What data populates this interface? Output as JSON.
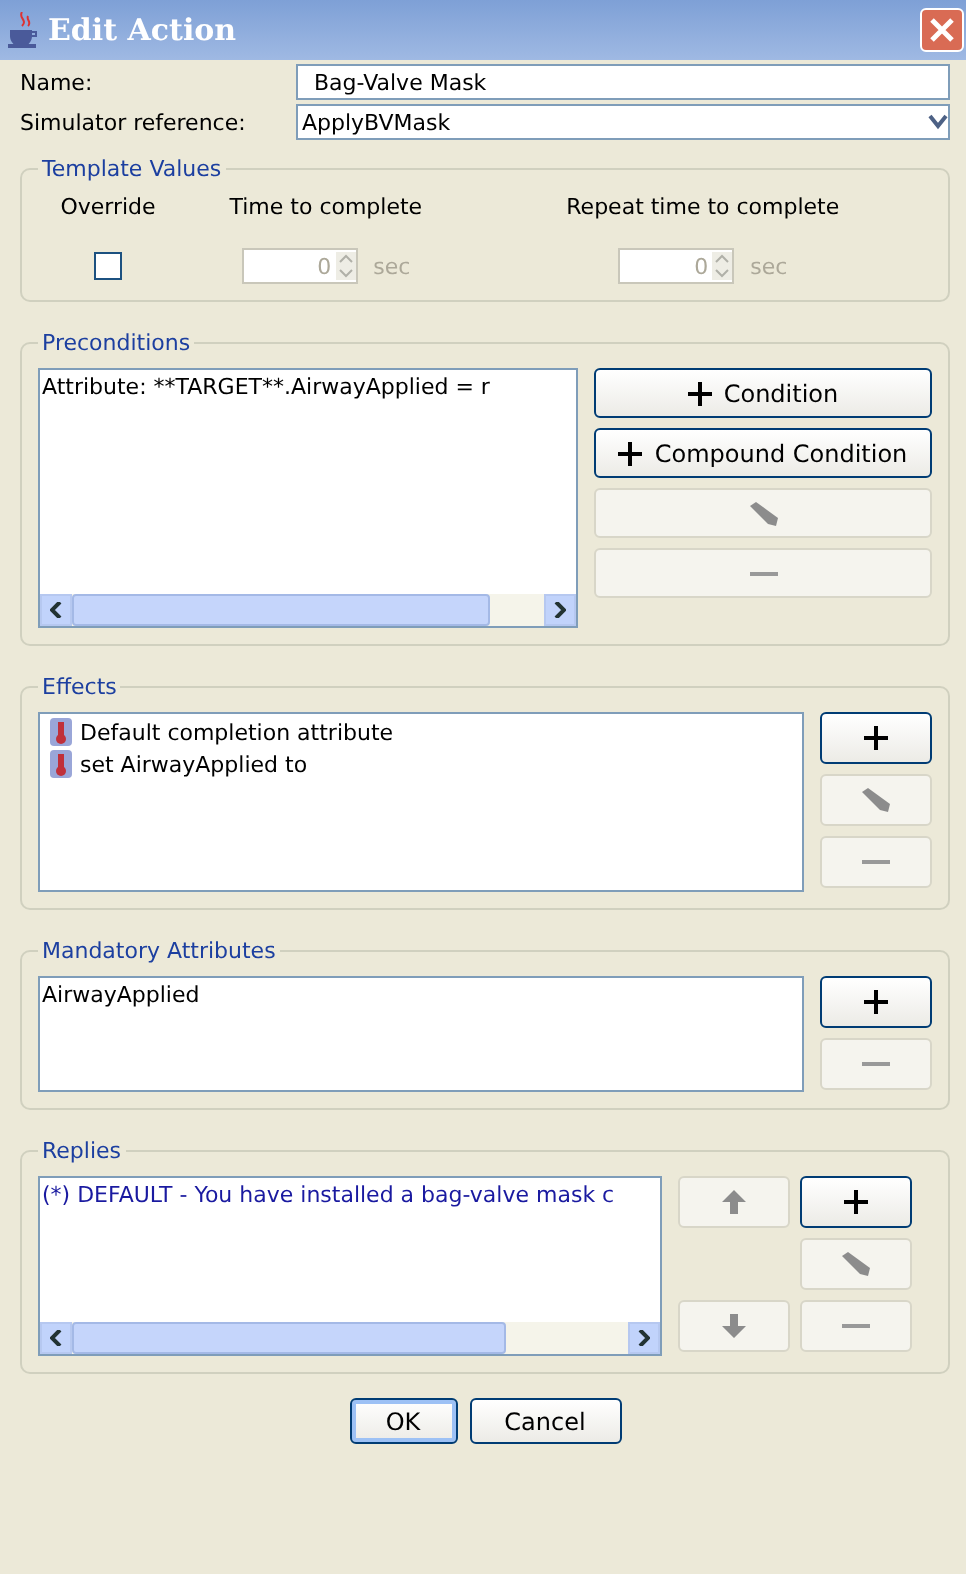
{
  "window": {
    "title": "Edit Action"
  },
  "name_field": {
    "label": "Name:",
    "value": "Bag-Valve Mask"
  },
  "simulator_reference": {
    "label": "Simulator reference:",
    "value": "ApplyBVMask"
  },
  "template_values": {
    "title": "Template Values",
    "override_label": "Override",
    "override_checked": false,
    "time_label": "Time to complete",
    "time_value": "0",
    "time_unit": "sec",
    "repeat_label": "Repeat time to complete",
    "repeat_value": "0",
    "repeat_unit": "sec",
    "disabled": true
  },
  "preconditions": {
    "title": "Preconditions",
    "items": [
      "Attribute: **TARGET**.AirwayApplied = r"
    ],
    "buttons": [
      {
        "kind": "add",
        "label": "Condition",
        "disabled": false
      },
      {
        "kind": "add",
        "label": "Compound Condition",
        "disabled": false
      },
      {
        "kind": "edit",
        "disabled": true
      },
      {
        "kind": "remove",
        "disabled": true
      }
    ]
  },
  "effects": {
    "title": "Effects",
    "items": [
      "Default completion attribute",
      "set AirwayApplied to"
    ],
    "buttons": [
      {
        "kind": "add",
        "disabled": false
      },
      {
        "kind": "edit",
        "disabled": true
      },
      {
        "kind": "remove",
        "disabled": true
      }
    ]
  },
  "mandatory_attributes": {
    "title": "Mandatory Attributes",
    "items": [
      "AirwayApplied"
    ],
    "buttons": [
      {
        "kind": "add",
        "disabled": false
      },
      {
        "kind": "remove",
        "disabled": true
      }
    ]
  },
  "replies": {
    "title": "Replies",
    "items": [
      "(*) DEFAULT - You have installed a bag-valve mask c"
    ],
    "buttons": [
      {
        "kind": "up",
        "disabled": true
      },
      {
        "kind": "add",
        "disabled": false
      },
      {
        "kind": "edit",
        "disabled": true
      },
      {
        "kind": "down",
        "disabled": true
      },
      {
        "kind": "remove",
        "disabled": true
      }
    ]
  },
  "buttons": [
    {
      "label": "OK",
      "focused": true
    },
    {
      "label": "Cancel",
      "focused": false
    }
  ]
}
